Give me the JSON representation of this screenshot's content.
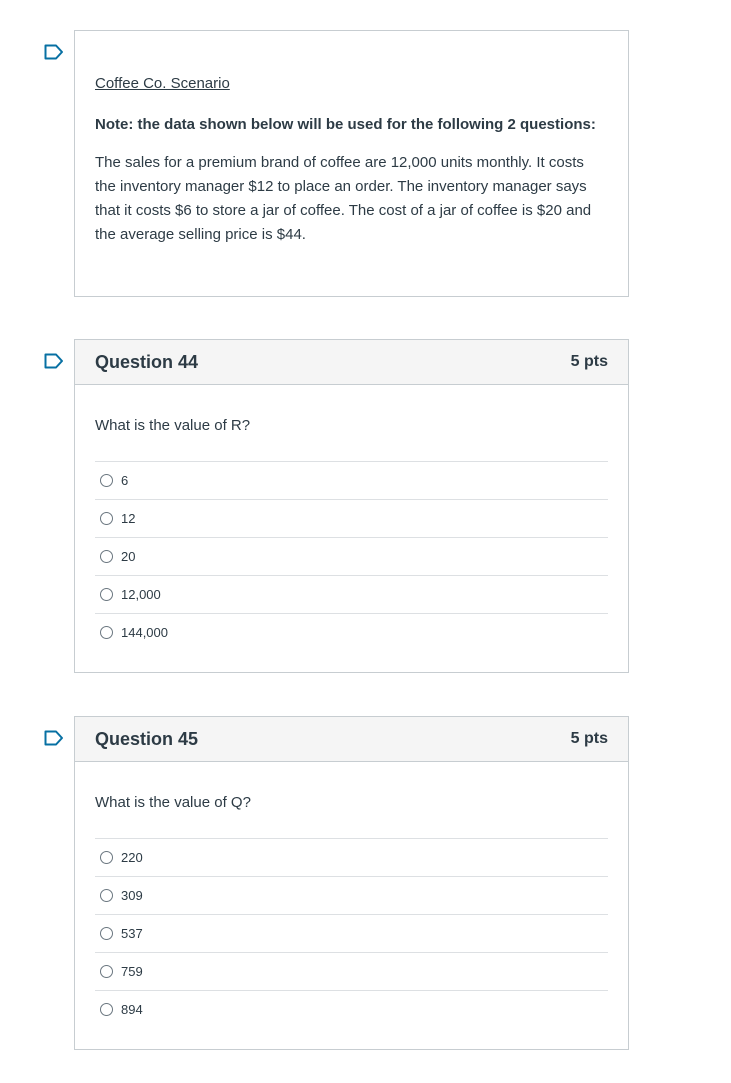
{
  "scenario": {
    "title": "Coffee Co. Scenario",
    "note": "Note: the data shown below will be used for the following 2 questions:",
    "body": "The sales for a premium brand of coffee are 12,000 units monthly. It costs the inventory manager $12 to place an order. The inventory manager says that it costs $6 to store a jar of coffee. The cost of a jar of coffee is $20 and the average selling price is $44."
  },
  "questions": [
    {
      "title": "Question 44",
      "points": "5 pts",
      "text": "What is the value of R?",
      "answers": [
        "6",
        "12",
        "20",
        "12,000",
        "144,000"
      ]
    },
    {
      "title": "Question 45",
      "points": "5 pts",
      "text": "What is the value of Q?",
      "answers": [
        "220",
        "309",
        "537",
        "759",
        "894"
      ]
    }
  ],
  "icons": {
    "flag": "bookmark-flag-icon"
  },
  "colors": {
    "flag": "#0770a3",
    "header_bg": "#f5f5f5",
    "border": "#c7cdd1",
    "text": "#2d3b45"
  }
}
